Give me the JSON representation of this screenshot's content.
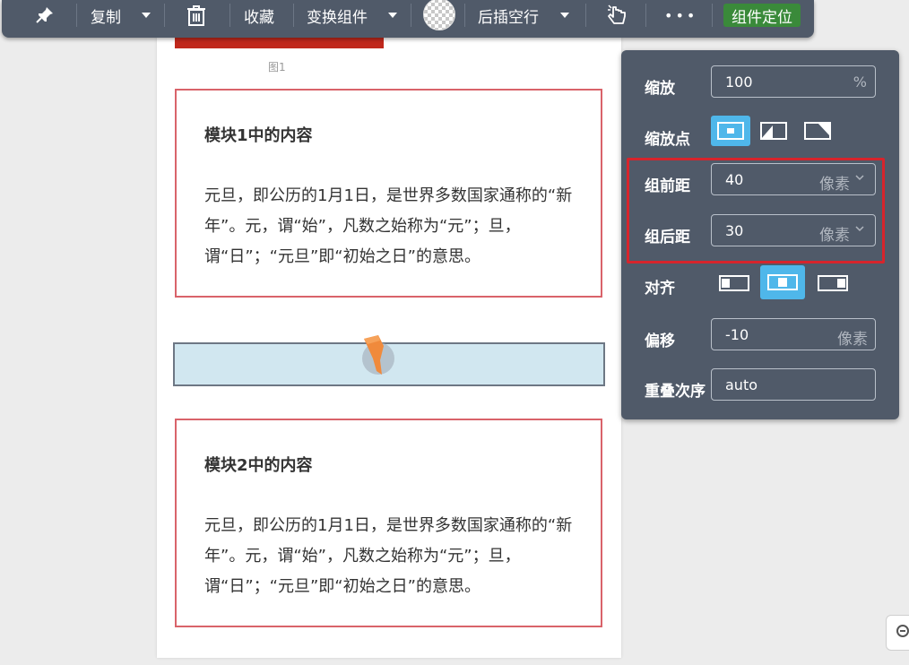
{
  "toolbar": {
    "copy_label": "复制",
    "favorite_label": "收藏",
    "transform_label": "变换组件",
    "insert_after_label": "后插空行",
    "more_label": "•••",
    "locate_label": "组件定位"
  },
  "canvas": {
    "figure_caption": "图1",
    "module1": {
      "title": "模块1中的内容",
      "body": "元旦，即公历的1月1日，是世界多数国家通称的“新年”。元，谓“始”，凡数之始称为“元”；旦，谓“日”；“元旦”即“初始之日”的意思。"
    },
    "module2": {
      "title": "模块2中的内容",
      "body": "元旦，即公历的1月1日，是世界多数国家通称的“新年”。元，谓“始”，凡数之始称为“元”；旦，谓“日”；“元旦”即“初始之日”的意思。"
    }
  },
  "panel": {
    "scale_label": "缩放",
    "scale_value": "100",
    "scale_unit": "%",
    "origin_label": "缩放点",
    "group_before_label": "组前距",
    "group_before_value": "40",
    "group_before_unit": "像素",
    "group_after_label": "组后距",
    "group_after_value": "30",
    "group_after_unit": "像素",
    "align_label": "对齐",
    "offset_label": "偏移",
    "offset_value": "-10",
    "offset_unit": "像素",
    "zindex_label": "重叠次序",
    "zindex_value": "auto"
  },
  "colors": {
    "toolbar_bg": "#505a69",
    "accent_blue": "#4fb7ea",
    "highlight_red": "#d7242c",
    "locate_green": "#3a8a3a"
  }
}
